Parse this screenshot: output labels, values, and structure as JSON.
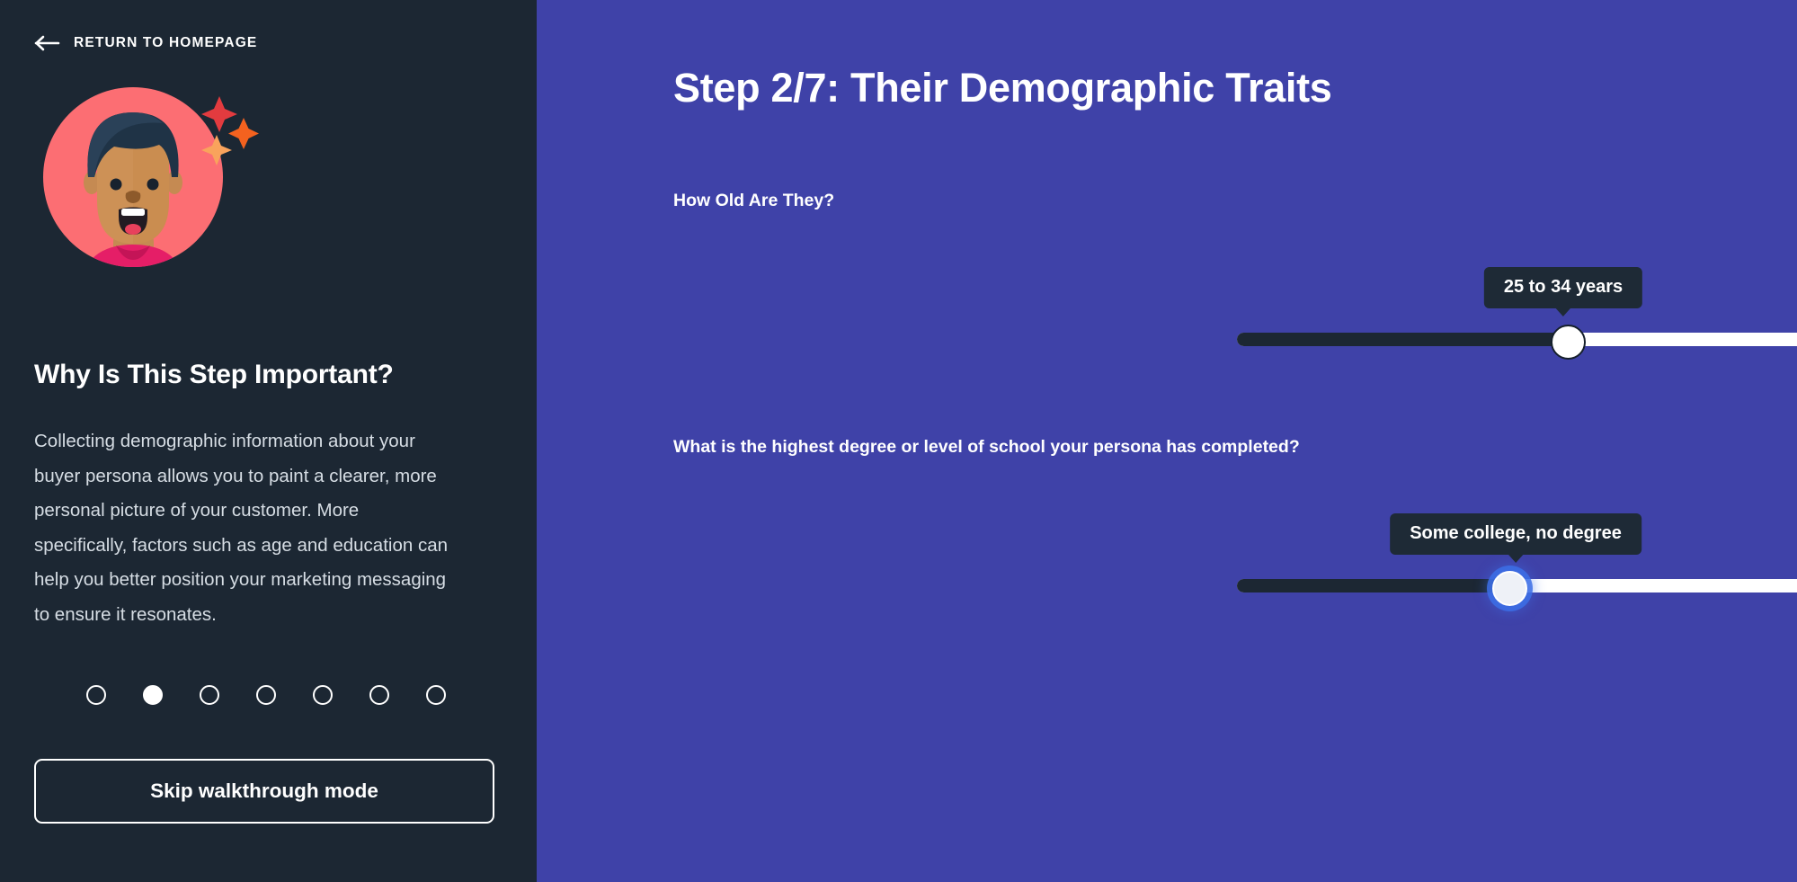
{
  "sidebar": {
    "return_link": {
      "label": "RETURN TO HOMEPAGE",
      "icon": "arrow-left-icon"
    },
    "avatar": {
      "icon": "persona-avatar-illustration"
    },
    "heading": "Why Is This Step Important?",
    "body": "Collecting demographic information about your buyer persona allows you to paint a clearer, more personal picture of your customer. More specifically, factors such as age and education can help you better position your marketing messaging to ensure it resonates.",
    "progress_dots": {
      "total": 7,
      "active_index": 1
    },
    "skip_button": "Skip walkthrough mode",
    "colors": {
      "background": "#1c2733",
      "text": "#ffffff",
      "body_text": "#d6dde4"
    }
  },
  "main": {
    "title": "Step 2/7: Their Demographic Traits",
    "colors": {
      "background": "#3f42a8",
      "track": "#ffffff",
      "track_fill": "#1c2733",
      "tooltip": "#1e2a36"
    },
    "fields": [
      {
        "label": "How Old Are They?",
        "control": "slider",
        "value_label": "25 to 34 years",
        "percent": 34
      },
      {
        "label": "What is the highest degree or level of school your persona has completed?",
        "control": "slider",
        "value_label": "Some college, no degree",
        "percent": 28
      }
    ]
  }
}
